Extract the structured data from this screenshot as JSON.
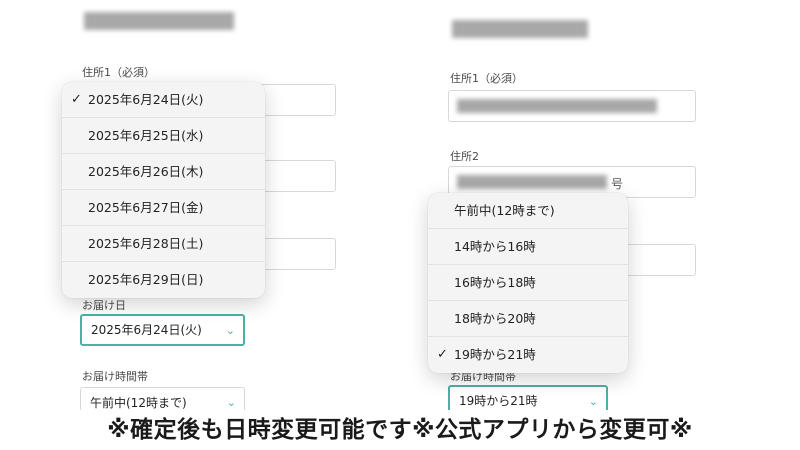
{
  "left": {
    "address1_label": "住所1（必須）",
    "delivery_date_label": "お届け日",
    "delivery_date_value": "2025年6月24日(火)",
    "delivery_time_label": "お届け時間帯",
    "delivery_time_value": "午前中(12時まで)",
    "date_options": [
      {
        "label": "2025年6月24日(火)",
        "selected": true
      },
      {
        "label": "2025年6月25日(水)",
        "selected": false
      },
      {
        "label": "2025年6月26日(木)",
        "selected": false
      },
      {
        "label": "2025年6月27日(金)",
        "selected": false
      },
      {
        "label": "2025年6月28日(土)",
        "selected": false
      },
      {
        "label": "2025年6月29日(日)",
        "selected": false
      }
    ]
  },
  "right": {
    "address1_label": "住所1（必須）",
    "address2_label": "住所2",
    "address2_suffix": "号",
    "delivery_time_label": "お届け時間帯",
    "delivery_time_value": "19時から21時",
    "time_options": [
      {
        "label": "午前中(12時まで)",
        "selected": false
      },
      {
        "label": "14時から16時",
        "selected": false
      },
      {
        "label": "16時から18時",
        "selected": false
      },
      {
        "label": "18時から20時",
        "selected": false
      },
      {
        "label": "19時から21時",
        "selected": true
      }
    ]
  },
  "icons": {
    "check": "✓",
    "chevron": "⌄"
  },
  "caption": "※確定後も日時変更可能です※公式アプリから変更可※",
  "colors": {
    "accent": "#4cb0a6"
  }
}
